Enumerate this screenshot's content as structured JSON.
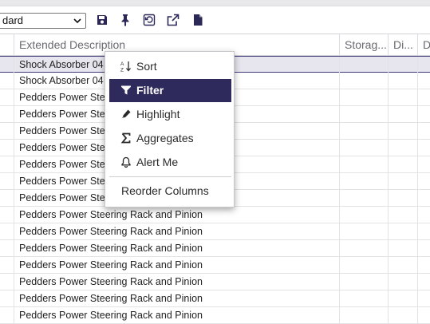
{
  "toolbar": {
    "view_select_value": "dard",
    "icons": [
      "save-icon",
      "pin-icon",
      "restore-icon",
      "export-icon",
      "document-icon"
    ]
  },
  "grid": {
    "columns": [
      "",
      "Extended Description",
      "Storag...",
      "Di...",
      "D"
    ],
    "rows": [
      {
        "description": "Shock Absorber 04"
      },
      {
        "description": "Shock Absorber 04"
      },
      {
        "description": "Pedders Power Ste"
      },
      {
        "description": "Pedders Power Ste"
      },
      {
        "description": "Pedders Power Ste"
      },
      {
        "description": "Pedders Power Ste"
      },
      {
        "description": "Pedders Power Ste"
      },
      {
        "description": "Pedders Power Ste"
      },
      {
        "description": "Pedders Power Ste"
      },
      {
        "description": "Pedders Power Steering Rack and Pinion"
      },
      {
        "description": "Pedders Power Steering Rack and Pinion"
      },
      {
        "description": "Pedders Power Steering Rack and Pinion"
      },
      {
        "description": "Pedders Power Steering Rack and Pinion"
      },
      {
        "description": "Pedders Power Steering Rack and Pinion"
      },
      {
        "description": "Pedders Power Steering Rack and Pinion"
      },
      {
        "description": "Pedders Power Steering Rack and Pinion"
      }
    ]
  },
  "context_menu": {
    "items": [
      {
        "label": "Sort",
        "icon": "sort-icon"
      },
      {
        "label": "Filter",
        "icon": "filter-icon"
      },
      {
        "label": "Highlight",
        "icon": "highlight-icon"
      },
      {
        "label": "Aggregates",
        "icon": "sigma-icon"
      },
      {
        "label": "Alert Me",
        "icon": "bell-icon"
      }
    ],
    "reorder_label": "Reorder Columns"
  },
  "colors": {
    "accent": "#2e2a5c",
    "selected_row": "#e7e6ee",
    "header_text": "#6a6a70"
  }
}
